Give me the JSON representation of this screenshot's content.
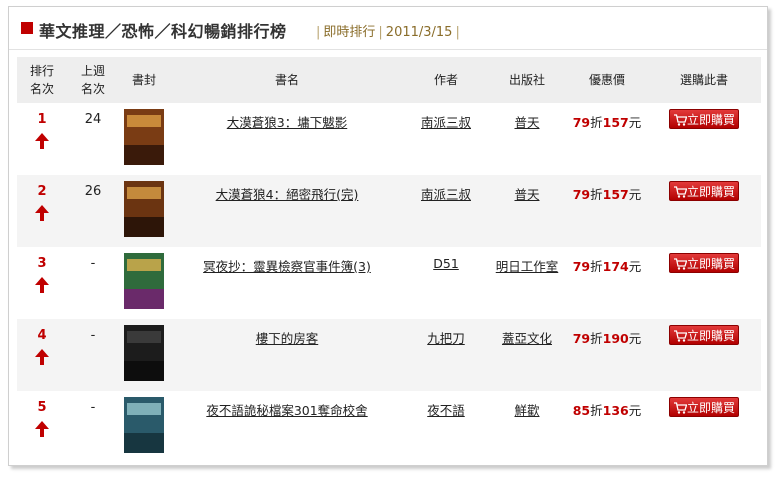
{
  "header": {
    "title": "華文推理／恐怖／科幻暢銷排行榜",
    "sub1": "即時排行",
    "sub2": "2011/3/15"
  },
  "columns": [
    "排行\n名次",
    "上週\n名次",
    "書封",
    "書名",
    "作者",
    "出版社",
    "優惠價",
    "選購此書"
  ],
  "col_rank": [
    "排行",
    "名次"
  ],
  "col_last": [
    "上週",
    "名次"
  ],
  "rows": [
    {
      "rank": "1",
      "last": "24",
      "title": "大漠蒼狼3：墉下魃影",
      "author": "南派三叔",
      "publisher": "普天",
      "discount": "79",
      "zhe": "折",
      "price": "157",
      "unit": "元",
      "buy": "立即購買",
      "cover_colors": [
        "#7a3c14",
        "#c98a3a",
        "#3a1a0a"
      ]
    },
    {
      "rank": "2",
      "last": "26",
      "title": "大漠蒼狼4：絕密飛行(完)",
      "author": "南派三叔",
      "publisher": "普天",
      "discount": "79",
      "zhe": "折",
      "price": "157",
      "unit": "元",
      "buy": "立即購買",
      "cover_colors": [
        "#6b3411",
        "#c48a3c",
        "#2d1508"
      ]
    },
    {
      "rank": "3",
      "last": "-",
      "title": "冥夜抄：靈異檢察官事件簿(3)",
      "author": "D51",
      "publisher": "明日工作室",
      "discount": "79",
      "zhe": "折",
      "price": "174",
      "unit": "元",
      "buy": "立即購買",
      "cover_colors": [
        "#2f6b3c",
        "#b9a34a",
        "#6a2a6a"
      ]
    },
    {
      "rank": "4",
      "last": "-",
      "title": "樓下的房客",
      "author": "九把刀",
      "publisher": "蓋亞文化",
      "discount": "79",
      "zhe": "折",
      "price": "190",
      "unit": "元",
      "buy": "立即購買",
      "cover_colors": [
        "#1c1c1c",
        "#3a3a3a",
        "#0d0d0d"
      ]
    },
    {
      "rank": "5",
      "last": "-",
      "title": "夜不語詭秘檔案301奪命校舍",
      "author": "夜不語",
      "publisher": "鮮歡",
      "discount": "85",
      "zhe": "折",
      "price": "136",
      "unit": "元",
      "buy": "立即購買",
      "cover_colors": [
        "#2a5a6a",
        "#7fb0b8",
        "#173640"
      ]
    }
  ],
  "colors": {
    "accent": "#c00000",
    "header_bg": "#eeeeee",
    "row_alt": "#f4f4f4"
  }
}
